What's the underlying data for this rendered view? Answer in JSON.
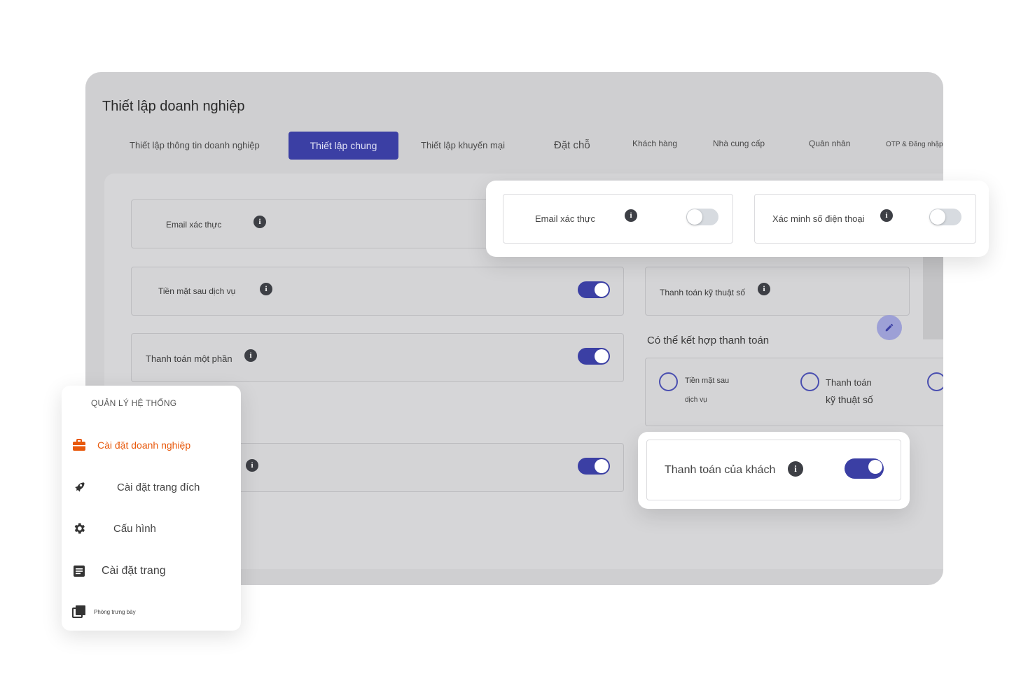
{
  "page": {
    "title": "Thiết lập doanh nghiệp",
    "tabs": [
      {
        "label": "Thiết lập thông tin doanh nghiệp"
      },
      {
        "label": "Thiết lập chung",
        "active": true
      },
      {
        "label": "Thiết lập khuyến mại"
      },
      {
        "label": "Đặt chỗ"
      },
      {
        "label": "Khách hàng"
      },
      {
        "label": "Nhà cung cấp"
      },
      {
        "label": "Quân nhân"
      },
      {
        "label": "OTP & Đăng nhập"
      }
    ]
  },
  "settings": {
    "email_verify": {
      "label": "Email xác thực",
      "enabled": false
    },
    "phone_verify": {
      "label": "Xác minh số điện thoại",
      "enabled": false
    },
    "cash_after_service": {
      "label": "Tiền mặt sau dịch vụ",
      "enabled": true
    },
    "digital_payment": {
      "label": "Thanh toán kỹ thuật số"
    },
    "partial_payment": {
      "label": "Thanh toán một phần",
      "enabled": true
    },
    "unnamed_toggle": {
      "enabled": true
    },
    "combine_title": "Có thể kết hợp thanh toán",
    "combine_options": [
      {
        "line1": "Tiền mặt sau",
        "line2": "dịch vụ"
      },
      {
        "line1": "Thanh toán",
        "line2": "kỹ thuật số"
      }
    ],
    "guest_payment": {
      "label": "Thanh toán của khách",
      "enabled": true
    }
  },
  "menu": {
    "header": "QUẢN LÝ HỆ THỐNG",
    "items": [
      {
        "label": "Cài đặt doanh nghiệp",
        "icon": "briefcase-icon",
        "active": true
      },
      {
        "label": "Cài đặt trang đích",
        "icon": "rocket-icon"
      },
      {
        "label": "Cấu hình",
        "icon": "gear-icon"
      },
      {
        "label": "Cài đặt trang",
        "icon": "document-icon"
      },
      {
        "label": "Phòng trưng bày",
        "icon": "gallery-icon"
      }
    ]
  },
  "colors": {
    "accent": "#3b3fa4",
    "active_menu": "#e8590c",
    "overlay": "#cfcfd1"
  }
}
